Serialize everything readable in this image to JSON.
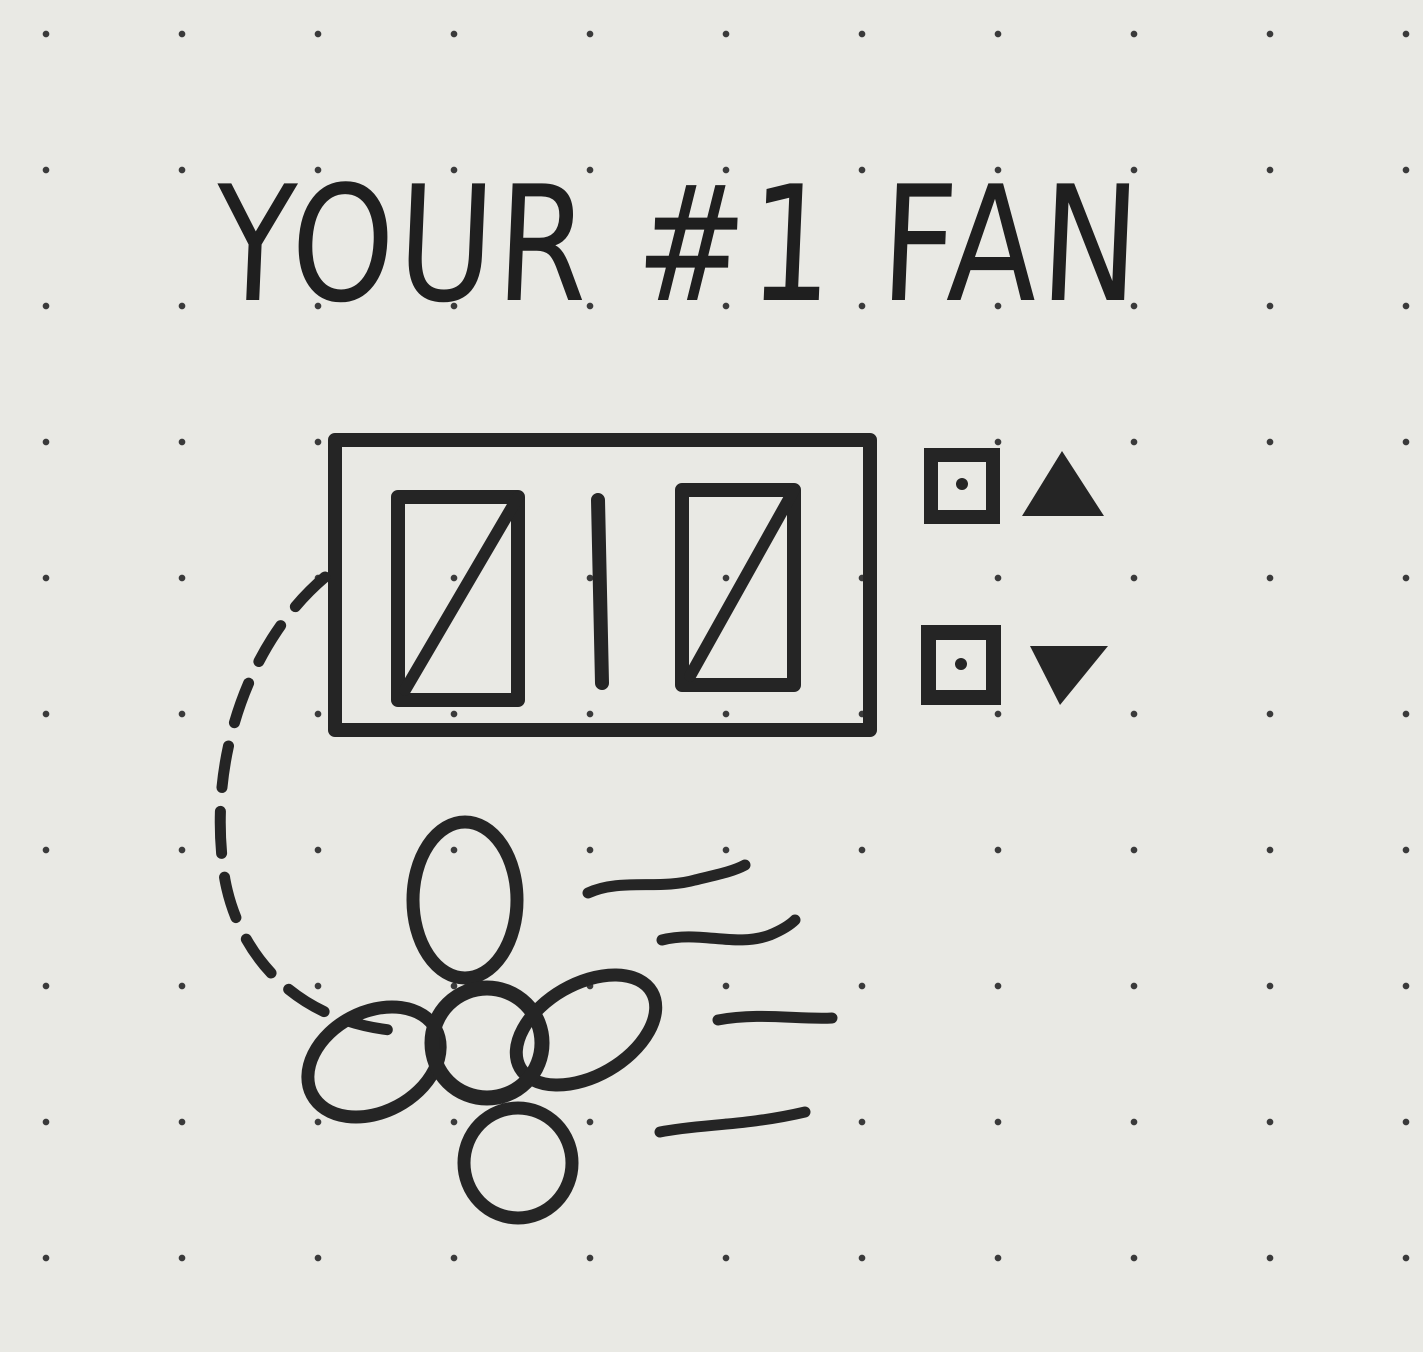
{
  "title": "YOUR #1 FAN",
  "display": {
    "digits": [
      "0",
      "1",
      "0"
    ]
  },
  "controls": {
    "up_icon": "triangle-up-icon",
    "down_icon": "triangle-down-icon"
  },
  "colors": {
    "ink": "#252525",
    "paper": "#e9e9e4"
  }
}
